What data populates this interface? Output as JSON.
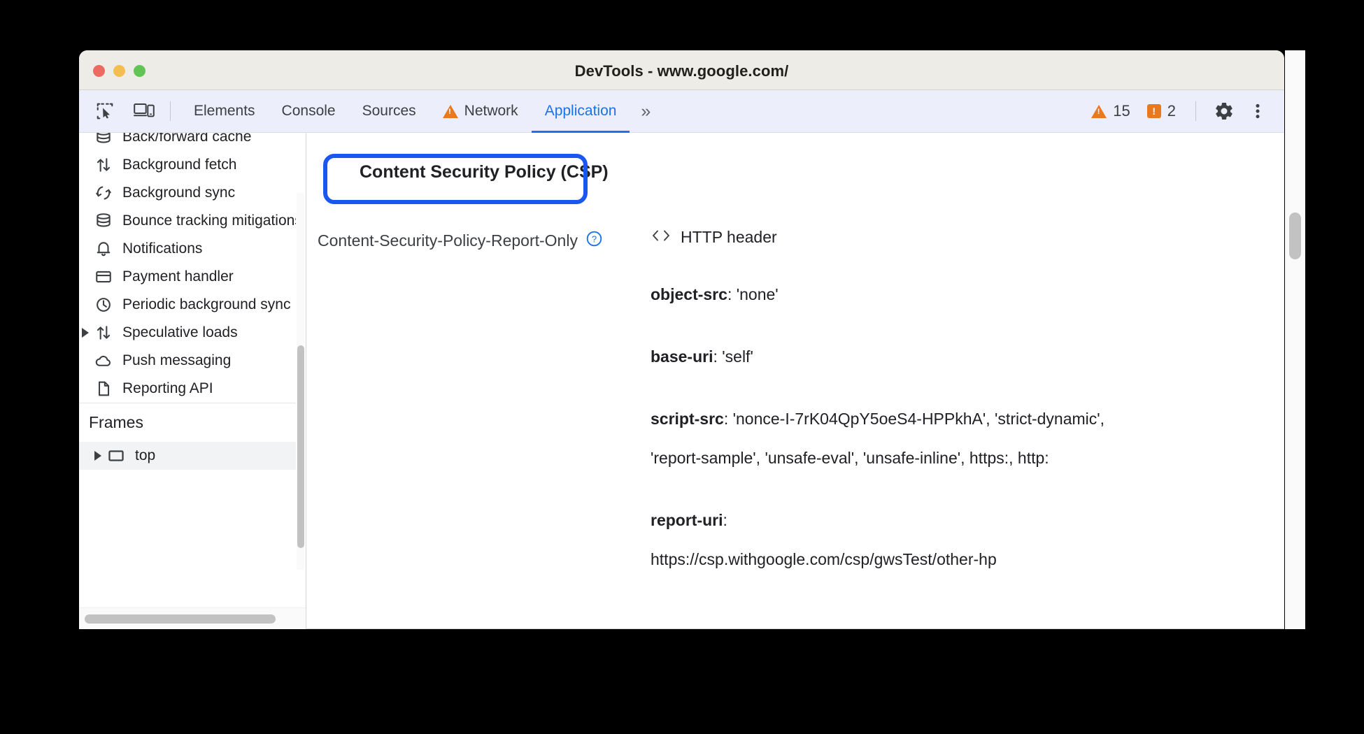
{
  "window": {
    "title": "DevTools - www.google.com/",
    "traffic_lights": [
      "close",
      "minimize",
      "maximize"
    ]
  },
  "toolbar": {
    "inspect_icon": "inspect-element-icon",
    "device_icon": "device-toolbar-icon",
    "tabs": [
      {
        "label": "Elements",
        "active": false,
        "warning": false
      },
      {
        "label": "Console",
        "active": false,
        "warning": false
      },
      {
        "label": "Sources",
        "active": false,
        "warning": false
      },
      {
        "label": "Network",
        "active": false,
        "warning": true
      },
      {
        "label": "Application",
        "active": true,
        "warning": false
      }
    ],
    "more_tabs_label": "»",
    "warning_count": "15",
    "error_count": "2",
    "settings_icon": "gear-icon",
    "menu_icon": "kebab-menu-icon"
  },
  "sidebar": {
    "items": [
      {
        "label": "Back/forward cache",
        "icon": "database-icon",
        "expandable": false
      },
      {
        "label": "Background fetch",
        "icon": "sync-arrows-icon",
        "expandable": false
      },
      {
        "label": "Background sync",
        "icon": "refresh-cycle-icon",
        "expandable": false
      },
      {
        "label": "Bounce tracking mitigations",
        "icon": "database-icon",
        "expandable": false
      },
      {
        "label": "Notifications",
        "icon": "bell-icon",
        "expandable": false
      },
      {
        "label": "Payment handler",
        "icon": "credit-card-icon",
        "expandable": false
      },
      {
        "label": "Periodic background sync",
        "icon": "clock-icon",
        "expandable": false
      },
      {
        "label": "Speculative loads",
        "icon": "sync-arrows-icon",
        "expandable": true
      },
      {
        "label": "Push messaging",
        "icon": "cloud-icon",
        "expandable": false
      },
      {
        "label": "Reporting API",
        "icon": "document-icon",
        "expandable": false
      }
    ],
    "frames_section": "Frames",
    "frames": [
      {
        "label": "top",
        "icon": "frame-icon",
        "expandable": true,
        "selected": true
      }
    ]
  },
  "main": {
    "heading": "Content Security Policy (CSP)",
    "highlight_color": "#1a56f0",
    "policy_label": "Content-Security-Policy-Report-Only",
    "help_icon": "help-circle-icon",
    "source_icon": "code-brackets-icon",
    "source_label": "HTTP header",
    "directives": [
      {
        "name": "object-src",
        "value": "'none'"
      },
      {
        "name": "base-uri",
        "value": "'self'"
      },
      {
        "name": "script-src",
        "value": "'nonce-I-7rK04QpY5oeS4-HPPkhA', 'strict-dynamic', 'report-sample', 'unsafe-eval', 'unsafe-inline', https:, http:"
      },
      {
        "name": "report-uri",
        "value": "https://csp.withgoogle.com/csp/gwsTest/other-hp"
      }
    ]
  }
}
